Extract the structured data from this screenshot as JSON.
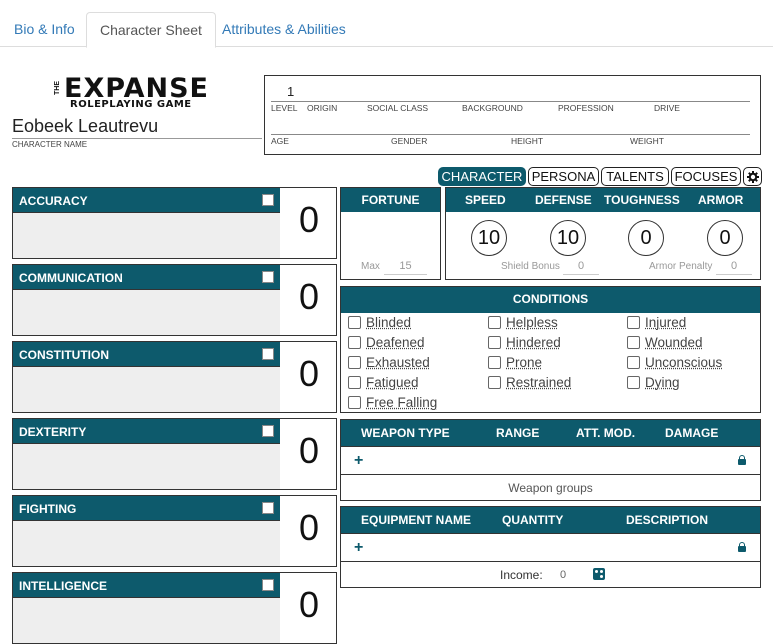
{
  "tabs": [
    {
      "label": "Bio & Info"
    },
    {
      "label": "Character Sheet"
    },
    {
      "label": "Attributes & Abilities"
    }
  ],
  "logo": {
    "the": "THE",
    "title": "EXPANSE",
    "subtitle": "ROLEPLAYING GAME"
  },
  "character": {
    "name": "Eobeek Leautrevu",
    "name_label": "CHARACTER NAME"
  },
  "bio": {
    "level_value": "1",
    "labels": {
      "level": "LEVEL",
      "origin": "ORIGIN",
      "social_class": "SOCIAL CLASS",
      "background": "BACKGROUND",
      "profession": "PROFESSION",
      "drive": "DRIVE",
      "age": "AGE",
      "gender": "GENDER",
      "height": "HEIGHT",
      "weight": "WEIGHT"
    }
  },
  "nav": {
    "character": "CHARACTER",
    "persona": "PERSONA",
    "talents": "TALENTS",
    "focuses": "FOCUSES",
    "gear_icon": "gear-icon"
  },
  "abilities": [
    {
      "name": "ACCURACY",
      "score": "0"
    },
    {
      "name": "COMMUNICATION",
      "score": "0"
    },
    {
      "name": "CONSTITUTION",
      "score": "0"
    },
    {
      "name": "DEXTERITY",
      "score": "0"
    },
    {
      "name": "FIGHTING",
      "score": "0"
    },
    {
      "name": "INTELLIGENCE",
      "score": "0"
    }
  ],
  "fortune": {
    "title": "FORTUNE",
    "max_label": "Max",
    "max_value": "15"
  },
  "stats": {
    "speed": {
      "label": "SPEED",
      "value": "10"
    },
    "defense": {
      "label": "DEFENSE",
      "value": "10"
    },
    "toughness": {
      "label": "TOUGHNESS",
      "value": "0"
    },
    "armor": {
      "label": "ARMOR",
      "value": "0"
    },
    "shield_bonus_label": "Shield Bonus",
    "shield_bonus_value": "0",
    "armor_penalty_label": "Armor Penalty",
    "armor_penalty_value": "0"
  },
  "conditions": {
    "title": "CONDITIONS",
    "items": [
      "Blinded",
      "Helpless",
      "Injured",
      "Deafened",
      "Hindered",
      "Wounded",
      "Exhausted",
      "Prone",
      "Unconscious",
      "Fatigued",
      "Restrained",
      "Dying",
      "Free Falling"
    ]
  },
  "weapons": {
    "headers": {
      "type": "WEAPON TYPE",
      "range": "RANGE",
      "att_mod": "ATT. MOD.",
      "damage": "DAMAGE"
    },
    "add": "+",
    "footer": "Weapon groups"
  },
  "equipment": {
    "headers": {
      "name": "EQUIPMENT NAME",
      "quantity": "QUANTITY",
      "description": "DESCRIPTION"
    },
    "add": "+",
    "income_label": "Income:",
    "income_value": "0"
  },
  "colors": {
    "accent": "#0d5a6c",
    "link": "#337ab7"
  }
}
